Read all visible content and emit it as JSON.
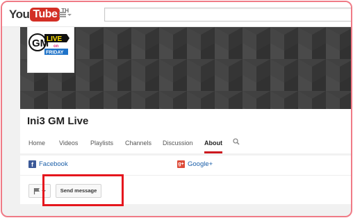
{
  "header": {
    "logo_you": "You",
    "logo_tube": "Tube",
    "logo_region": "TH",
    "guide_icon": "hamburger-menu-icon",
    "search_placeholder": ""
  },
  "channel": {
    "avatar_text_top": "GM",
    "avatar_text_live": "LIVE",
    "avatar_text_on": "on",
    "avatar_text_friday": "FRIDAY",
    "title": "Ini3 GM Live",
    "tabs": [
      {
        "label": "Home",
        "active": false
      },
      {
        "label": "Videos",
        "active": false
      },
      {
        "label": "Playlists",
        "active": false
      },
      {
        "label": "Channels",
        "active": false
      },
      {
        "label": "Discussion",
        "active": false
      },
      {
        "label": "About",
        "active": true
      }
    ],
    "search_icon": "magnifier-icon"
  },
  "about": {
    "links": [
      {
        "label": "Facebook",
        "icon": "facebook-icon"
      },
      {
        "label": "Google+",
        "icon": "google-plus-icon"
      }
    ],
    "flag_icon": "flag-icon",
    "send_message_label": "Send message"
  },
  "colors": {
    "accent_red": "#cc181e",
    "youtube_red": "#d32f25",
    "link_blue": "#1a5ea8",
    "highlight_red": "#e5161d",
    "frame_pink": "#f07a86"
  }
}
